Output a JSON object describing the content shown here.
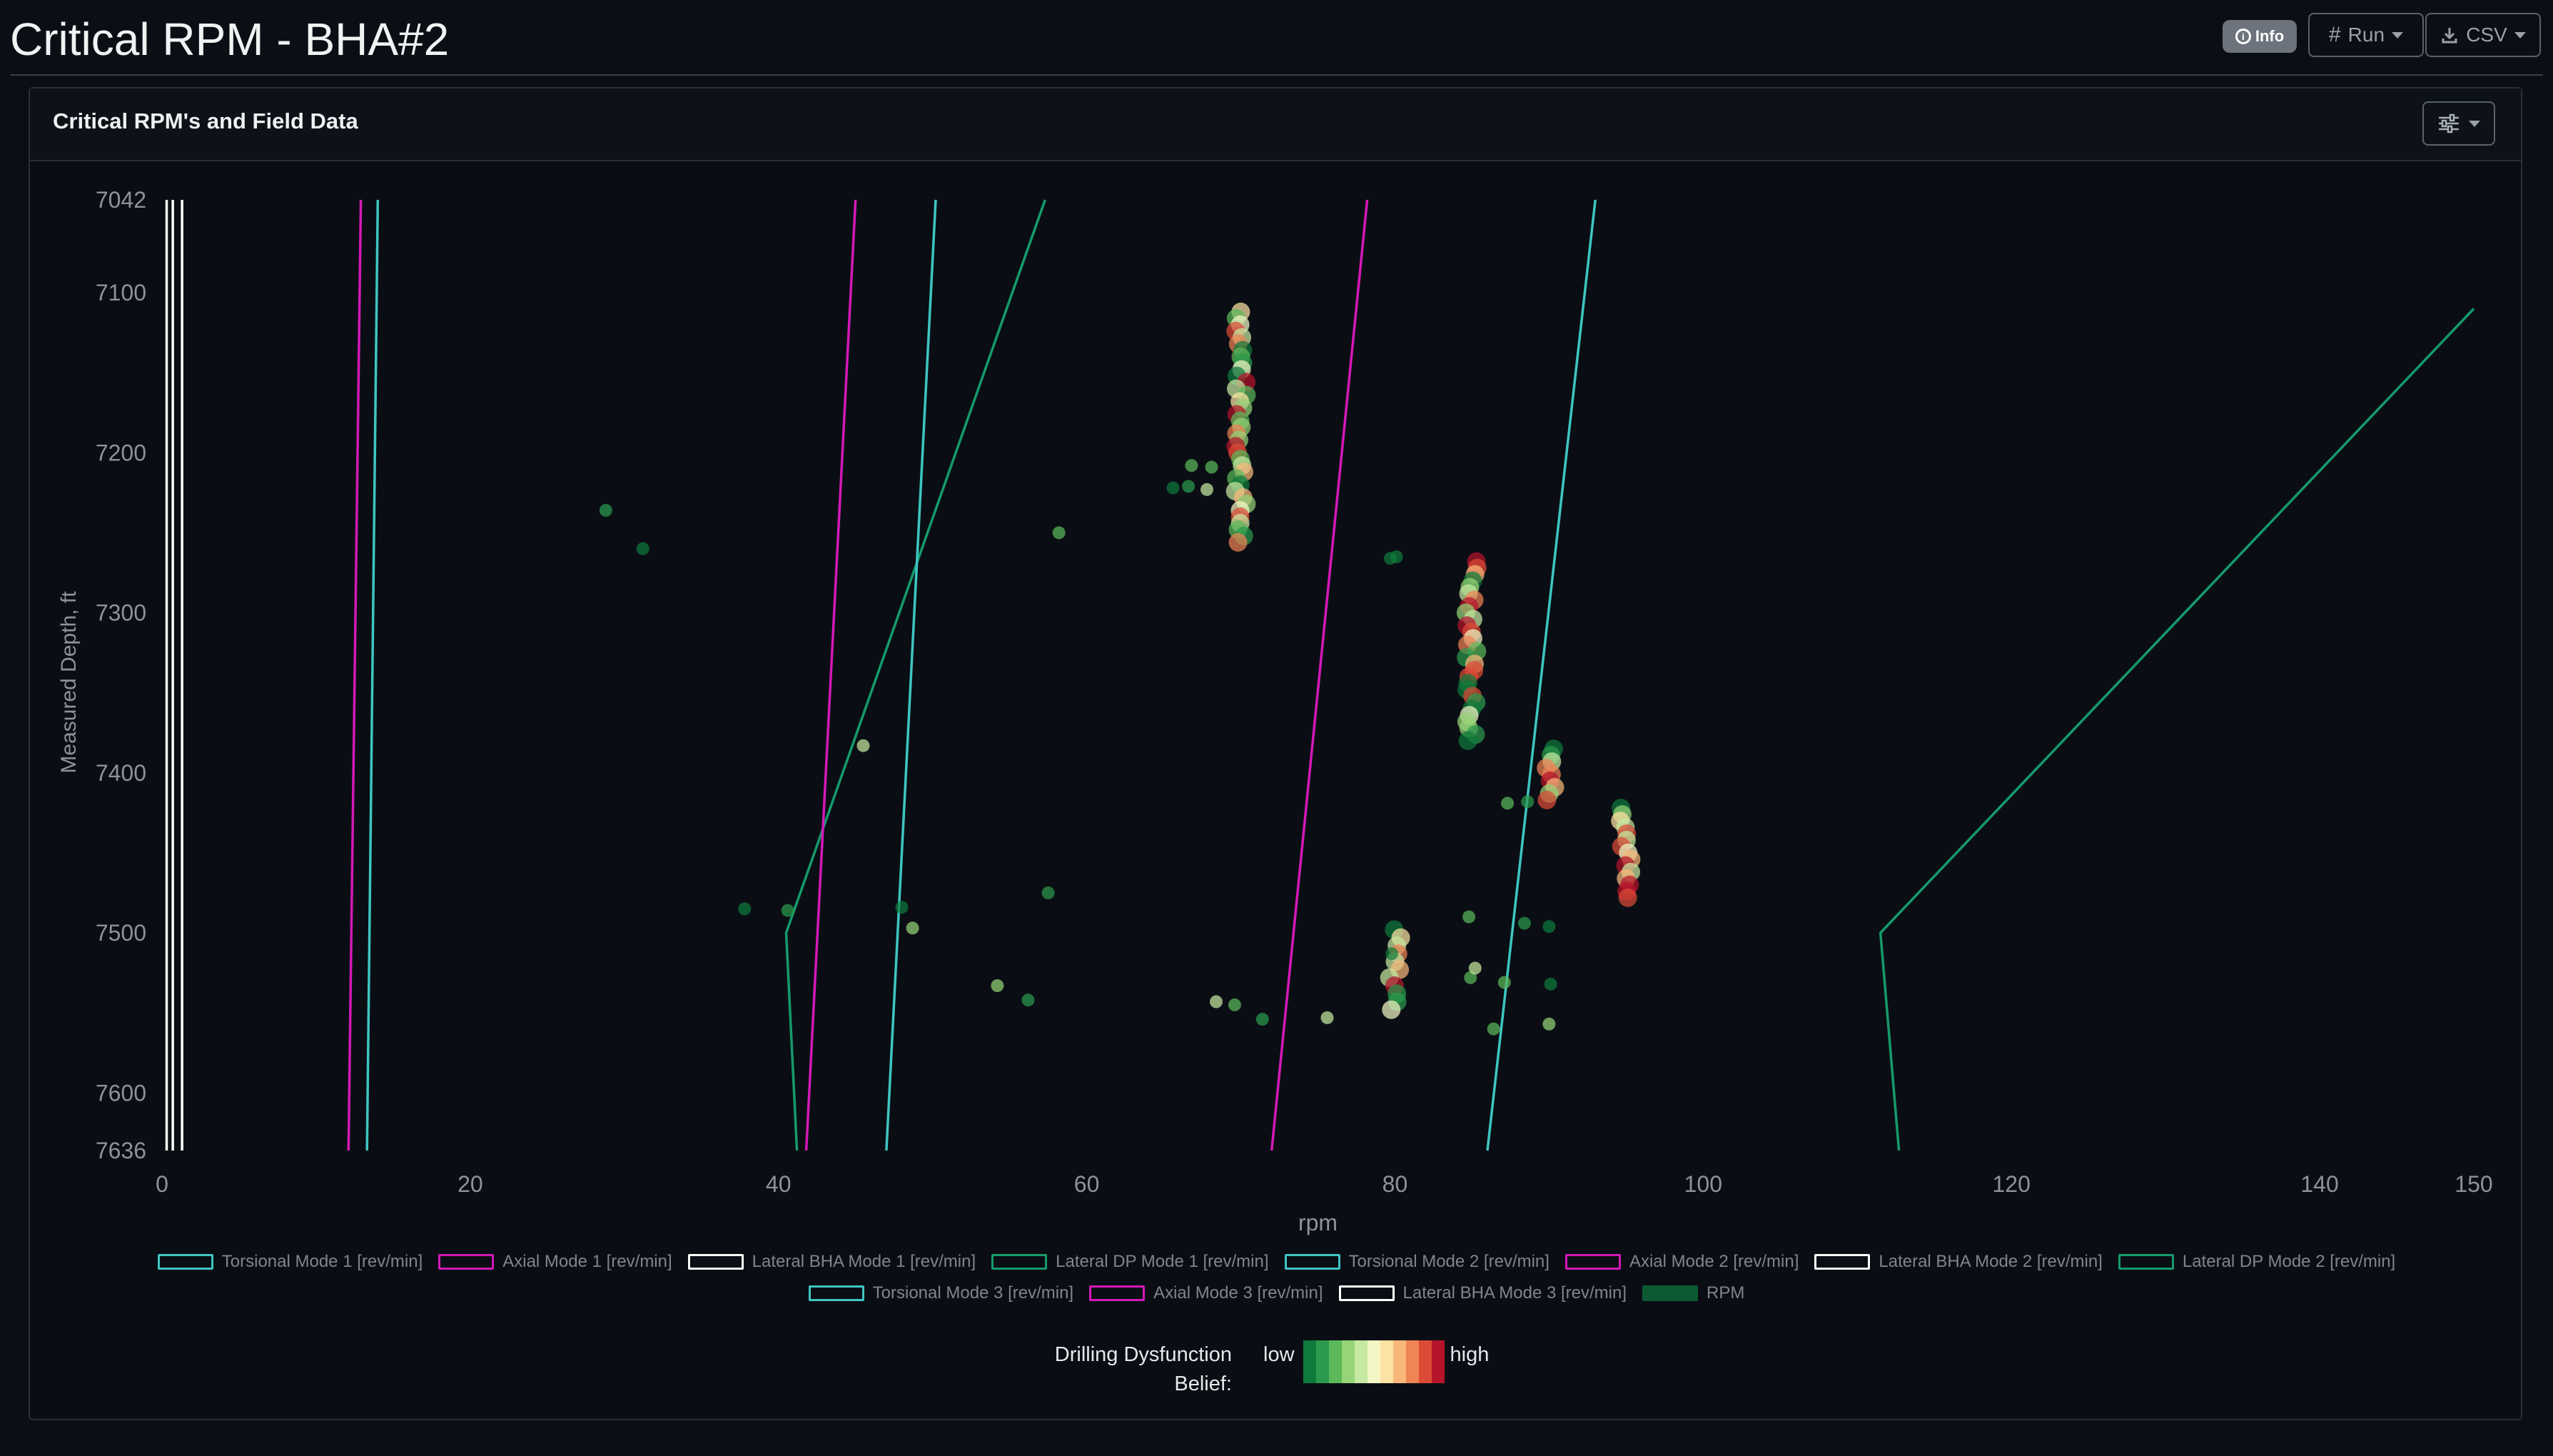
{
  "page": {
    "title": "Critical RPM - BHA#2"
  },
  "toolbar": {
    "info_label": "Info",
    "run_label": "Run",
    "csv_label": "CSV",
    "info_icon": "info-circle-icon",
    "run_icon": "hash-icon",
    "csv_icon": "download-icon",
    "settings_icon": "sliders-icon"
  },
  "card": {
    "title": "Critical RPM's and Field Data"
  },
  "colors": {
    "torsional": "#3ec6c2",
    "axial": "#d418b8",
    "lateral_bha": "#ffffff",
    "lateral_dp": "#159a6c",
    "rpm": "#0b5a33"
  },
  "chart_data": {
    "type": "line",
    "xlabel": "rpm",
    "ylabel": "Measured Depth, ft",
    "xlim": [
      0,
      150
    ],
    "ylim": [
      7636,
      7042
    ],
    "x_ticks": [
      "0",
      "20",
      "40",
      "60",
      "80",
      "100",
      "120",
      "140",
      "150"
    ],
    "x_tick_values": [
      0,
      20,
      40,
      60,
      80,
      100,
      120,
      140,
      150
    ],
    "y_ticks": [
      "7042",
      "7100",
      "7200",
      "7300",
      "7400",
      "7500",
      "7600",
      "7636"
    ],
    "y_tick_values": [
      7042,
      7100,
      7200,
      7300,
      7400,
      7500,
      7600,
      7636
    ],
    "grid": false,
    "legend_position": "bottom",
    "series": [
      {
        "name": "Torsional Mode 1 [rev/min]",
        "color": "#3ec6c2",
        "x": [
          14.0,
          13.3
        ],
        "y": [
          7042,
          7636
        ]
      },
      {
        "name": "Axial Mode 1 [rev/min]",
        "color": "#d418b8",
        "x": [
          12.9,
          12.1
        ],
        "y": [
          7042,
          7636
        ]
      },
      {
        "name": "Lateral BHA Mode 1 [rev/min]",
        "color": "#ffffff",
        "x": [
          0.3,
          0.3
        ],
        "y": [
          7042,
          7636
        ]
      },
      {
        "name": "Lateral DP Mode 1 [rev/min]",
        "color": "#159a6c",
        "x": [
          57.3,
          40.5,
          41.2
        ],
        "y": [
          7042,
          7500,
          7636
        ]
      },
      {
        "name": "Torsional Mode 2 [rev/min]",
        "color": "#3ec6c2",
        "x": [
          50.2,
          47.0
        ],
        "y": [
          7042,
          7636
        ]
      },
      {
        "name": "Axial Mode 2 [rev/min]",
        "color": "#d418b8",
        "x": [
          45.0,
          41.8
        ],
        "y": [
          7042,
          7636
        ]
      },
      {
        "name": "Lateral BHA Mode 2 [rev/min]",
        "color": "#ffffff",
        "x": [
          0.7,
          0.7
        ],
        "y": [
          7042,
          7636
        ]
      },
      {
        "name": "Lateral DP Mode 2 [rev/min]",
        "color": "#159a6c",
        "x": [
          150.0,
          111.5,
          112.7
        ],
        "y": [
          7110,
          7500,
          7636
        ]
      },
      {
        "name": "Torsional Mode 3 [rev/min]",
        "color": "#3ec6c2",
        "x": [
          93.0,
          86.0
        ],
        "y": [
          7042,
          7636
        ]
      },
      {
        "name": "Axial Mode 3 [rev/min]",
        "color": "#d418b8",
        "x": [
          78.2,
          72.0
        ],
        "y": [
          7042,
          7636
        ]
      },
      {
        "name": "Lateral BHA Mode 3 [rev/min]",
        "color": "#ffffff",
        "x": [
          1.3,
          1.3
        ],
        "y": [
          7042,
          7636
        ]
      }
    ],
    "rpm_series": {
      "name": "RPM",
      "clusters": [
        {
          "x": 70.0,
          "y_from": 7112,
          "y_to": 7258,
          "step": 4
        },
        {
          "x": 85.0,
          "y_from": 7268,
          "y_to": 7380,
          "step": 4
        },
        {
          "x": 90.2,
          "y_from": 7385,
          "y_to": 7418,
          "step": 4
        },
        {
          "x": 95.0,
          "y_from": 7422,
          "y_to": 7480,
          "step": 4
        },
        {
          "x": 80.0,
          "y_from": 7498,
          "y_to": 7550,
          "step": 5
        }
      ],
      "points": [
        [
          28.8,
          7236
        ],
        [
          31.2,
          7260
        ],
        [
          45.5,
          7383
        ],
        [
          58.2,
          7250
        ],
        [
          37.8,
          7485
        ],
        [
          40.6,
          7486
        ],
        [
          48.0,
          7484
        ],
        [
          48.7,
          7497
        ],
        [
          57.5,
          7475
        ],
        [
          54.2,
          7533
        ],
        [
          56.2,
          7542
        ],
        [
          68.4,
          7543
        ],
        [
          69.6,
          7545
        ],
        [
          71.4,
          7554
        ],
        [
          75.6,
          7553
        ],
        [
          65.6,
          7222
        ],
        [
          66.6,
          7221
        ],
        [
          66.8,
          7208
        ],
        [
          67.8,
          7223
        ],
        [
          68.1,
          7209
        ],
        [
          79.7,
          7266
        ],
        [
          80.1,
          7265
        ],
        [
          87.3,
          7419
        ],
        [
          88.6,
          7418
        ],
        [
          86.4,
          7560
        ],
        [
          87.1,
          7531
        ],
        [
          88.4,
          7494
        ],
        [
          90.0,
          7496
        ],
        [
          90.1,
          7532
        ],
        [
          90.0,
          7557
        ],
        [
          84.8,
          7490
        ],
        [
          84.9,
          7528
        ],
        [
          85.2,
          7522
        ],
        [
          79.8,
          7513
        ]
      ]
    },
    "belief_scale": {
      "title": "Drilling Dysfunction Belief:",
      "low": "low",
      "high": "high",
      "colors": [
        "#0f7a3c",
        "#2b9a4c",
        "#5bb95a",
        "#95d477",
        "#c6e9a1",
        "#f3f6c4",
        "#fde3a3",
        "#f9b87a",
        "#ef8454",
        "#dc4b36",
        "#b5142b"
      ]
    }
  }
}
